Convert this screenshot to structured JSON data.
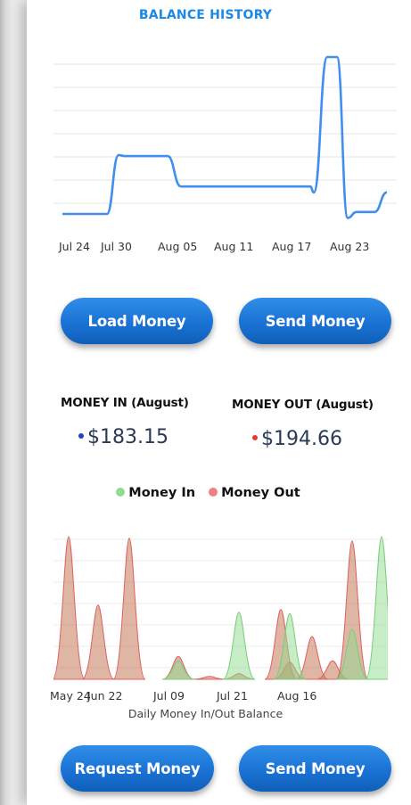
{
  "balance_history": {
    "title": "BALANCE HISTORY",
    "x_labels": [
      "Jul 24",
      "Jul 30",
      "Aug 05",
      "Aug 11",
      "Aug 17",
      "Aug 23"
    ]
  },
  "buttons": {
    "load_money": "Load Money",
    "send_money_top": "Send Money",
    "request_money": "Request Money",
    "send_money_bottom": "Send Money"
  },
  "stats": {
    "money_in_label": "MONEY IN (August)",
    "money_in_value": "$183.15",
    "money_out_label": "MONEY OUT (August)",
    "money_out_value": "$194.66"
  },
  "legend": {
    "money_in": "Money In",
    "money_out": "Money Out"
  },
  "daily_chart": {
    "x_labels": [
      "May 24",
      "Jun 22",
      "Jul 09",
      "Jul 21",
      "Aug 16"
    ],
    "caption": "Daily Money In/Out Balance"
  },
  "colors": {
    "accent": "#1a8ae6",
    "line": "#3f8ef0",
    "money_in": "#8fdc8f",
    "money_out": "#f08080",
    "money_in_dot": "#1f3fcc",
    "money_out_dot": "#e53935"
  },
  "chart_data": [
    {
      "type": "line",
      "title": "BALANCE HISTORY",
      "x": [
        "Jul 24",
        "Jul 30",
        "Aug 05",
        "Aug 11",
        "Aug 17",
        "Aug 23"
      ],
      "grid": true,
      "series": [
        {
          "values": [
            0.0,
            0.0,
            0.0,
            0.6,
            0.59,
            0.59,
            0.59,
            0.28,
            0.28,
            0.28,
            0.28,
            0.28,
            0.28,
            0.22,
            1.6,
            1.6,
            -0.04,
            0.02,
            0.02,
            0.22
          ]
        }
      ]
    },
    {
      "type": "area",
      "title": "Daily Money In/Out Balance",
      "x": [
        "May 24",
        "Jun 22",
        "Jul 09",
        "Jul 21",
        "Aug 16"
      ],
      "grid": true,
      "legend": "top-center",
      "series": [
        {
          "name": "Money In",
          "peaks": [
            0,
            0,
            0,
            0.13,
            0,
            0.47,
            0,
            0.46,
            0,
            0,
            0.35,
            1.0
          ]
        },
        {
          "name": "Money Out",
          "peaks": [
            1.0,
            0.52,
            0.99,
            0.16,
            0.02,
            0.04,
            0.49,
            0.12,
            0.3,
            0.13,
            0.97,
            0
          ]
        }
      ]
    }
  ]
}
